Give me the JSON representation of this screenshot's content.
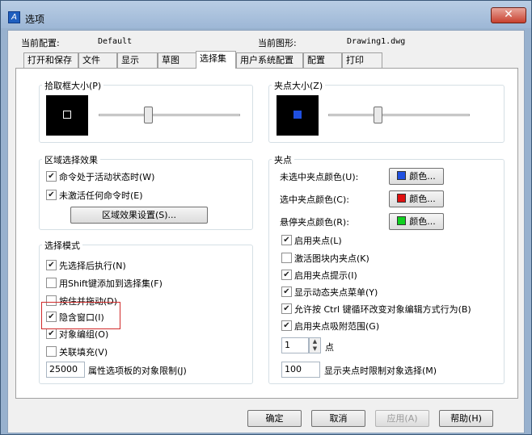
{
  "window": {
    "title": "选项",
    "close_glyph": "✕",
    "app_icon_glyph": "A"
  },
  "header": {
    "current_profile_label": "当前配置:",
    "current_profile_value": "Default",
    "current_drawing_label": "当前图形:",
    "current_drawing_value": "Drawing1.dwg"
  },
  "tabs": [
    {
      "label": "打开和保存"
    },
    {
      "label": "文件"
    },
    {
      "label": "显示"
    },
    {
      "label": "草图"
    },
    {
      "label": "选择集"
    },
    {
      "label": "用户系统配置"
    },
    {
      "label": "配置"
    },
    {
      "label": "打印"
    }
  ],
  "pickbox": {
    "title": "拾取框大小(P)",
    "slider_level": 0.35
  },
  "grip_size": {
    "title": "夹点大小(Z)",
    "slider_level": 0.35
  },
  "region_effect": {
    "title": "区域选择效果",
    "items": [
      {
        "label": "命令处于活动状态时(W)",
        "checked": true
      },
      {
        "label": "未激活任何命令时(E)",
        "checked": true
      }
    ],
    "settings_button": "区域效果设置(S)..."
  },
  "selection_mode": {
    "title": "选择模式",
    "items": [
      {
        "label": "先选择后执行(N)",
        "checked": true
      },
      {
        "label": "用Shift键添加到选择集(F)",
        "checked": false
      },
      {
        "label": "按住并拖动(D)",
        "checked": false
      },
      {
        "label": "隐含窗口(I)",
        "checked": true
      },
      {
        "label": "对象编组(O)",
        "checked": true
      },
      {
        "label": "关联填充(V)",
        "checked": false
      }
    ],
    "object_limit_value": "25000",
    "object_limit_label": "属性选项板的对象限制(J)"
  },
  "grips": {
    "title": "夹点",
    "colors": [
      {
        "label": "未选中夹点颜色(U):",
        "button": "颜色...",
        "color": "#1f4fe0"
      },
      {
        "label": "选中夹点颜色(C):",
        "button": "颜色...",
        "color": "#e01010"
      },
      {
        "label": "悬停夹点颜色(R):",
        "button": "颜色...",
        "color": "#10d020"
      }
    ],
    "items": [
      {
        "label": "启用夹点(L)",
        "checked": true
      },
      {
        "label": "激活图块内夹点(K)",
        "checked": false
      },
      {
        "label": "启用夹点提示(I)",
        "checked": true
      },
      {
        "label": "显示动态夹点菜单(Y)",
        "checked": true
      },
      {
        "label": "允许按 Ctrl 键循环改变对象编辑方式行为(B)",
        "checked": true
      },
      {
        "label": "启用夹点吸附范围(G)",
        "checked": true
      }
    ],
    "snap_value": "1",
    "snap_unit": "点",
    "display_limit_value": "100",
    "display_limit_label": "显示夹点时限制对象选择(M)"
  },
  "footer": {
    "ok": "确定",
    "cancel": "取消",
    "apply": "应用(A)",
    "help": "帮助(H)"
  },
  "check_glyph": "✔",
  "spin_up_glyph": "▲",
  "spin_down_glyph": "▼",
  "colors": {
    "titlebar": "#9db7d6",
    "close_button": "#c8412f",
    "highlight_border": "#d12a2a"
  }
}
